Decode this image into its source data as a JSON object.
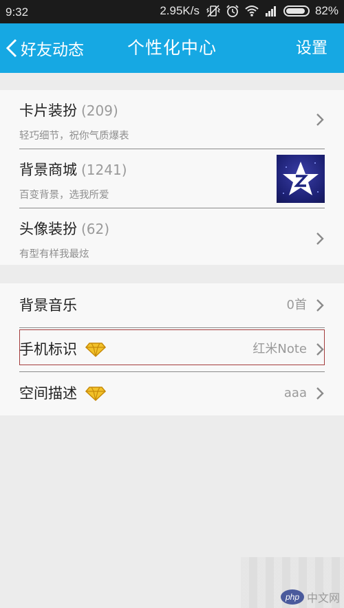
{
  "status_bar": {
    "time": "9:32",
    "net_speed": "2.95K/s",
    "battery": "82%"
  },
  "title_bar": {
    "back_label": "好友动态",
    "title": "个性化中心",
    "settings_label": "设置",
    "color": "#16a8e3"
  },
  "group1": [
    {
      "name": "卡片装扮",
      "count": "(209)",
      "sub": "轻巧细节，祝你气质爆表"
    },
    {
      "name": "背景商城",
      "count": "(1241)",
      "sub": "百变背景，选我所爱"
    },
    {
      "name": "头像装扮",
      "count": "(62)",
      "sub": "有型有样我最炫"
    }
  ],
  "group2": [
    {
      "name": "背景音乐",
      "value": "0首"
    },
    {
      "name": "手机标识",
      "value": "红米Note"
    },
    {
      "name": "空间描述",
      "value": "aaa"
    }
  ],
  "watermark": {
    "logo": "php",
    "text": "中文网"
  }
}
